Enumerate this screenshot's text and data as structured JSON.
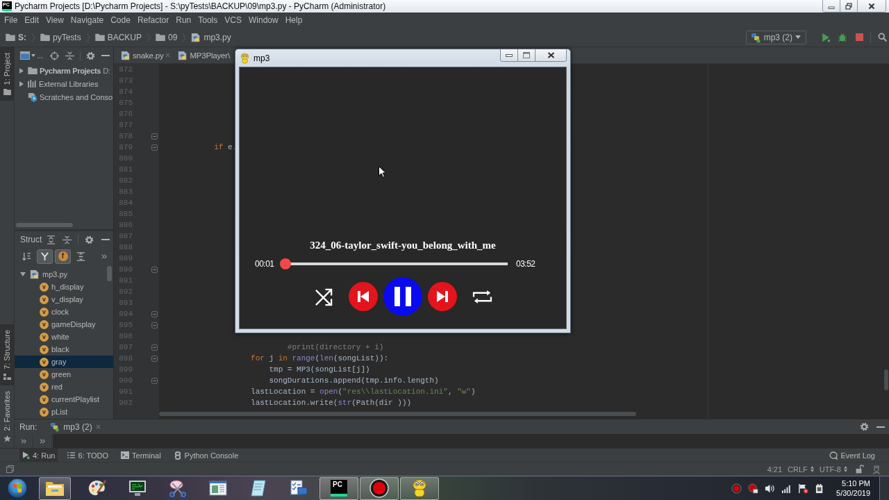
{
  "window": {
    "app_icon": "PC",
    "title": "Pycharm Projects [D:\\Pycharm Projects] - S:\\pyTests\\BACKUP\\09\\mp3.py - PyCharm (Administrator)"
  },
  "menu": [
    "File",
    "Edit",
    "View",
    "Navigate",
    "Code",
    "Refactor",
    "Run",
    "Tools",
    "VCS",
    "Window",
    "Help"
  ],
  "breadcrumbs": [
    {
      "label": "S:",
      "kind": "folder"
    },
    {
      "label": "pyTests",
      "kind": "folder"
    },
    {
      "label": "BACKUP",
      "kind": "folder"
    },
    {
      "label": "09",
      "kind": "folder"
    },
    {
      "label": "mp3.py",
      "kind": "python-file"
    }
  ],
  "run_config": {
    "label": "mp3 (2)"
  },
  "side_tabs": [
    {
      "label": "1: Project",
      "kind": "project",
      "selected": true
    },
    {
      "label": "7: Structure",
      "kind": "structure",
      "selected": true
    },
    {
      "label": "2: Favorites",
      "kind": "favorites",
      "selected": false
    }
  ],
  "project_panel": {
    "view_label": "...",
    "items": [
      {
        "label": "Pycharm Projects",
        "detail": "D:",
        "kind": "folder",
        "expanded": false
      },
      {
        "label": "External Libraries",
        "kind": "library",
        "expanded": false
      },
      {
        "label": "Scratches and Conso",
        "kind": "scratches"
      }
    ]
  },
  "structure_panel": {
    "title": "Struct",
    "toolbar": [
      {
        "kind": "sort",
        "on": false
      },
      {
        "kind": "inherited",
        "on": true
      },
      {
        "kind": "fields",
        "on": true,
        "glyph": "f"
      },
      {
        "kind": "autoscroll",
        "on": false
      }
    ],
    "tree": [
      {
        "label": "mp3.py",
        "kind": "python-file",
        "expanded": true,
        "children": [
          {
            "label": "h_display",
            "badge": "v",
            "selected": false
          },
          {
            "label": "v_display",
            "badge": "v",
            "selected": false
          },
          {
            "label": "clock",
            "badge": "v",
            "selected": false
          },
          {
            "label": "gameDisplay",
            "badge": "v",
            "selected": false
          },
          {
            "label": "white",
            "badge": "v",
            "selected": false
          },
          {
            "label": "black",
            "badge": "v",
            "selected": false
          },
          {
            "label": "gray",
            "badge": "v",
            "selected": true
          },
          {
            "label": "green",
            "badge": "v",
            "selected": false
          },
          {
            "label": "red",
            "badge": "v",
            "selected": false
          },
          {
            "label": "currentPlaylist",
            "badge": "v",
            "selected": false
          },
          {
            "label": "pList",
            "badge": "v",
            "selected": false
          }
        ]
      }
    ]
  },
  "editor": {
    "tabs": [
      {
        "label": "snake.py",
        "selected": false
      },
      {
        "label": "MP3Player\\",
        "selected": false
      }
    ],
    "lines": [
      {
        "number": "872",
        "fold": false
      },
      {
        "number": "873",
        "fold": false
      },
      {
        "number": "874",
        "fold": false
      },
      {
        "number": "875",
        "fold": false
      },
      {
        "number": "876",
        "fold": false
      },
      {
        "number": "877",
        "fold": false
      },
      {
        "number": "878",
        "fold": true
      },
      {
        "number": "879",
        "fold": true,
        "tokens": [
          {
            "text": "            if",
            "kind": "keyword"
          },
          {
            "text": " e.",
            "kind": "plain"
          }
        ]
      },
      {
        "number": "880",
        "fold": false
      },
      {
        "number": "881",
        "fold": false
      },
      {
        "number": "882",
        "fold": false
      },
      {
        "number": "883",
        "fold": false
      },
      {
        "number": "884",
        "fold": false
      },
      {
        "number": "885",
        "fold": false
      },
      {
        "number": "886",
        "fold": false
      },
      {
        "number": "887",
        "fold": false
      },
      {
        "number": "888",
        "fold": false
      },
      {
        "number": "889",
        "fold": false
      },
      {
        "number": "890",
        "fold": true
      },
      {
        "number": "891",
        "fold": false
      },
      {
        "number": "892",
        "fold": false
      },
      {
        "number": "893",
        "fold": false
      },
      {
        "number": "894",
        "fold": true
      },
      {
        "number": "895",
        "fold": true
      },
      {
        "number": "896",
        "fold": false
      },
      {
        "number": "897",
        "fold": true,
        "tokens": [
          {
            "text": "                            #print(directory + i)",
            "kind": "comment"
          }
        ]
      },
      {
        "number": "898",
        "fold": true,
        "tokens": [
          {
            "text": "                    for",
            "kind": "keyword"
          },
          {
            "text": " j ",
            "kind": "plain"
          },
          {
            "text": "in",
            "kind": "keyword"
          },
          {
            "text": " range",
            "kind": "builtin"
          },
          {
            "text": "(",
            "kind": "plain"
          },
          {
            "text": "len",
            "kind": "builtin"
          },
          {
            "text": "(songList)):",
            "kind": "plain"
          }
        ]
      },
      {
        "number": "899",
        "fold": false,
        "tokens": [
          {
            "text": "                        tmp = MP3(songList[j])",
            "kind": "plain"
          }
        ]
      },
      {
        "number": "900",
        "fold": true,
        "tokens": [
          {
            "text": "                        songDurations.append(tmp.info.length)",
            "kind": "plain"
          }
        ]
      },
      {
        "number": "901",
        "fold": false,
        "tokens": [
          {
            "text": "                    lastLocation = ",
            "kind": "plain"
          },
          {
            "text": "open",
            "kind": "builtin"
          },
          {
            "text": "(",
            "kind": "plain"
          },
          {
            "text": "\"res\\\\lastLocation.ini\"",
            "kind": "string"
          },
          {
            "text": ", ",
            "kind": "plain"
          },
          {
            "text": "\"w\"",
            "kind": "string"
          },
          {
            "text": ")",
            "kind": "plain"
          }
        ]
      },
      {
        "number": "902",
        "fold": false,
        "tokens": [
          {
            "text": "                    lastLocation.write(",
            "kind": "plain"
          },
          {
            "text": "str",
            "kind": "builtin"
          },
          {
            "text": "(Path(dir )))",
            "kind": "plain"
          }
        ]
      }
    ]
  },
  "run_panel": {
    "label": "Run:",
    "tabs": [
      {
        "label": "mp3 (2)"
      }
    ]
  },
  "tool_tabs": [
    {
      "label": "4: Run",
      "kind": "run",
      "selected": true
    },
    {
      "label": "6: TODO",
      "kind": "todo",
      "selected": false
    },
    {
      "label": "Terminal",
      "kind": "terminal",
      "selected": false
    },
    {
      "label": "Python Console",
      "kind": "console",
      "selected": false
    }
  ],
  "event_log": {
    "label": "Event Log"
  },
  "status_bar": {
    "position": "4:21",
    "line_separator": "CRLF",
    "encoding": "UTF-8"
  },
  "player": {
    "title": "mp3",
    "song": "324_06-taylor_swift-you_belong_with_me",
    "elapsed": "00:01",
    "total": "03:52",
    "progress": {
      "level": 0
    },
    "playing": true,
    "controls": [
      {
        "kind": "shuffle"
      },
      {
        "kind": "previous"
      },
      {
        "kind": "play-pause"
      },
      {
        "kind": "next"
      },
      {
        "kind": "repeat"
      }
    ]
  },
  "taskbar": {
    "apps": [
      {
        "kind": "explorer",
        "running": true
      },
      {
        "kind": "paint",
        "running": false
      },
      {
        "kind": "monitor",
        "running": false
      },
      {
        "kind": "snipping",
        "running": false
      },
      {
        "kind": "reader",
        "running": false
      },
      {
        "kind": "notepad",
        "running": false
      },
      {
        "kind": "checklist",
        "running": false
      },
      {
        "kind": "ide",
        "running": true,
        "logo": "PC"
      },
      {
        "kind": "recorder",
        "running": true
      },
      {
        "kind": "pygame",
        "running": true
      }
    ],
    "time": "5:10 PM",
    "date": "5/30/2019"
  }
}
